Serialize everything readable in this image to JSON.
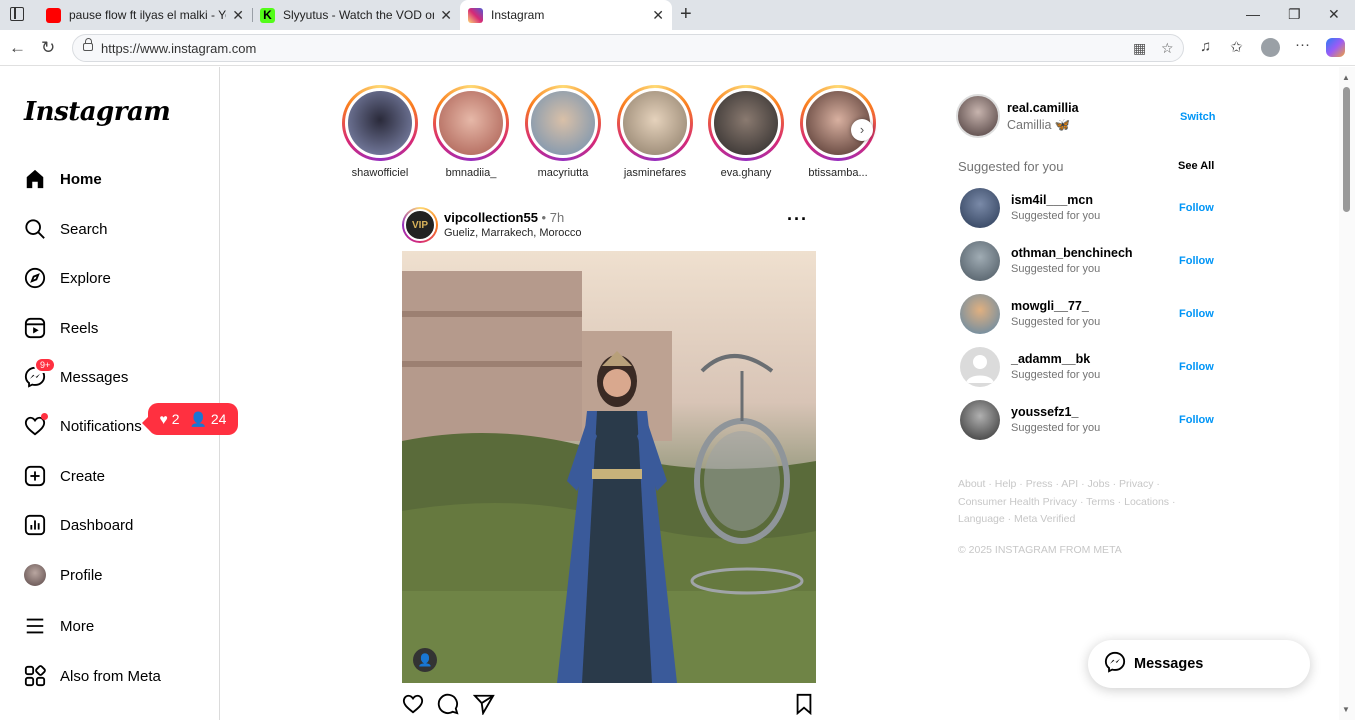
{
  "browser": {
    "tabs": [
      {
        "title": "pause flow ft ilyas el malki - YouT",
        "favicon_color": "#ff0000"
      },
      {
        "title": "Slyyutus - Watch the VOD on Kick",
        "favicon_color": "#53fc18",
        "favicon_letter": "K"
      },
      {
        "title": "Instagram",
        "favicon_color": "#d62976"
      }
    ],
    "url": "https://www.instagram.com"
  },
  "sidebar": {
    "logo": "Instagram",
    "items": [
      {
        "label": "Home",
        "icon": "home-icon"
      },
      {
        "label": "Search",
        "icon": "search-icon"
      },
      {
        "label": "Explore",
        "icon": "compass-icon"
      },
      {
        "label": "Reels",
        "icon": "reels-icon"
      },
      {
        "label": "Messages",
        "icon": "messenger-icon",
        "badge": "9+"
      },
      {
        "label": "Notifications",
        "icon": "heart-icon"
      },
      {
        "label": "Create",
        "icon": "plus-square-icon"
      },
      {
        "label": "Dashboard",
        "icon": "dashboard-icon"
      },
      {
        "label": "Profile",
        "icon": "avatar"
      },
      {
        "label": "More",
        "icon": "menu-icon"
      },
      {
        "label": "Also from Meta",
        "icon": "meta-grid-icon"
      }
    ],
    "notif_popup": {
      "likes": "2",
      "followers": "24"
    }
  },
  "stories": [
    {
      "name": "shawofficiel",
      "color": "#2a2a3a"
    },
    {
      "name": "bmnadiia_",
      "color": "#c97b6a"
    },
    {
      "name": "macyriutta",
      "color": "#8aa4c0"
    },
    {
      "name": "jasminefares",
      "color": "#a8967e"
    },
    {
      "name": "eva.ghany",
      "color": "#3c3a3a"
    },
    {
      "name": "btissamba...",
      "color": "#6b4a3e"
    }
  ],
  "post": {
    "username": "vipcollection55",
    "time": "7h",
    "location": "Gueliz, Marrakech, Morocco",
    "avatar_text": "VIP"
  },
  "account": {
    "username": "real.camillia",
    "display_name": "Camillia 🦋",
    "switch_label": "Switch"
  },
  "suggestions": {
    "title": "Suggested for you",
    "see_all": "See All",
    "follow_label": "Follow",
    "items": [
      {
        "username": "ism4il___mcn",
        "sub": "Suggested for you",
        "color": "#3b4a66"
      },
      {
        "username": "othman_benchinech",
        "sub": "Suggested for you",
        "color": "#6b7a86"
      },
      {
        "username": "mowgli__77_",
        "sub": "Suggested for you",
        "color": "#6e8fa8"
      },
      {
        "username": "_adamm__bk",
        "sub": "Suggested for you",
        "color": "#c8c8c8"
      },
      {
        "username": "youssefz1_",
        "sub": "Suggested for you",
        "color": "#555555"
      }
    ]
  },
  "footer": {
    "links": "About · Help · Press · API · Jobs · Privacy · Consumer Health Privacy · Terms · Locations · Language · Meta Verified",
    "copyright": "© 2025 INSTAGRAM FROM META"
  },
  "messages_float": {
    "label": "Messages"
  },
  "colors": {
    "accent": "#0095f6",
    "notification": "#ff3040"
  }
}
